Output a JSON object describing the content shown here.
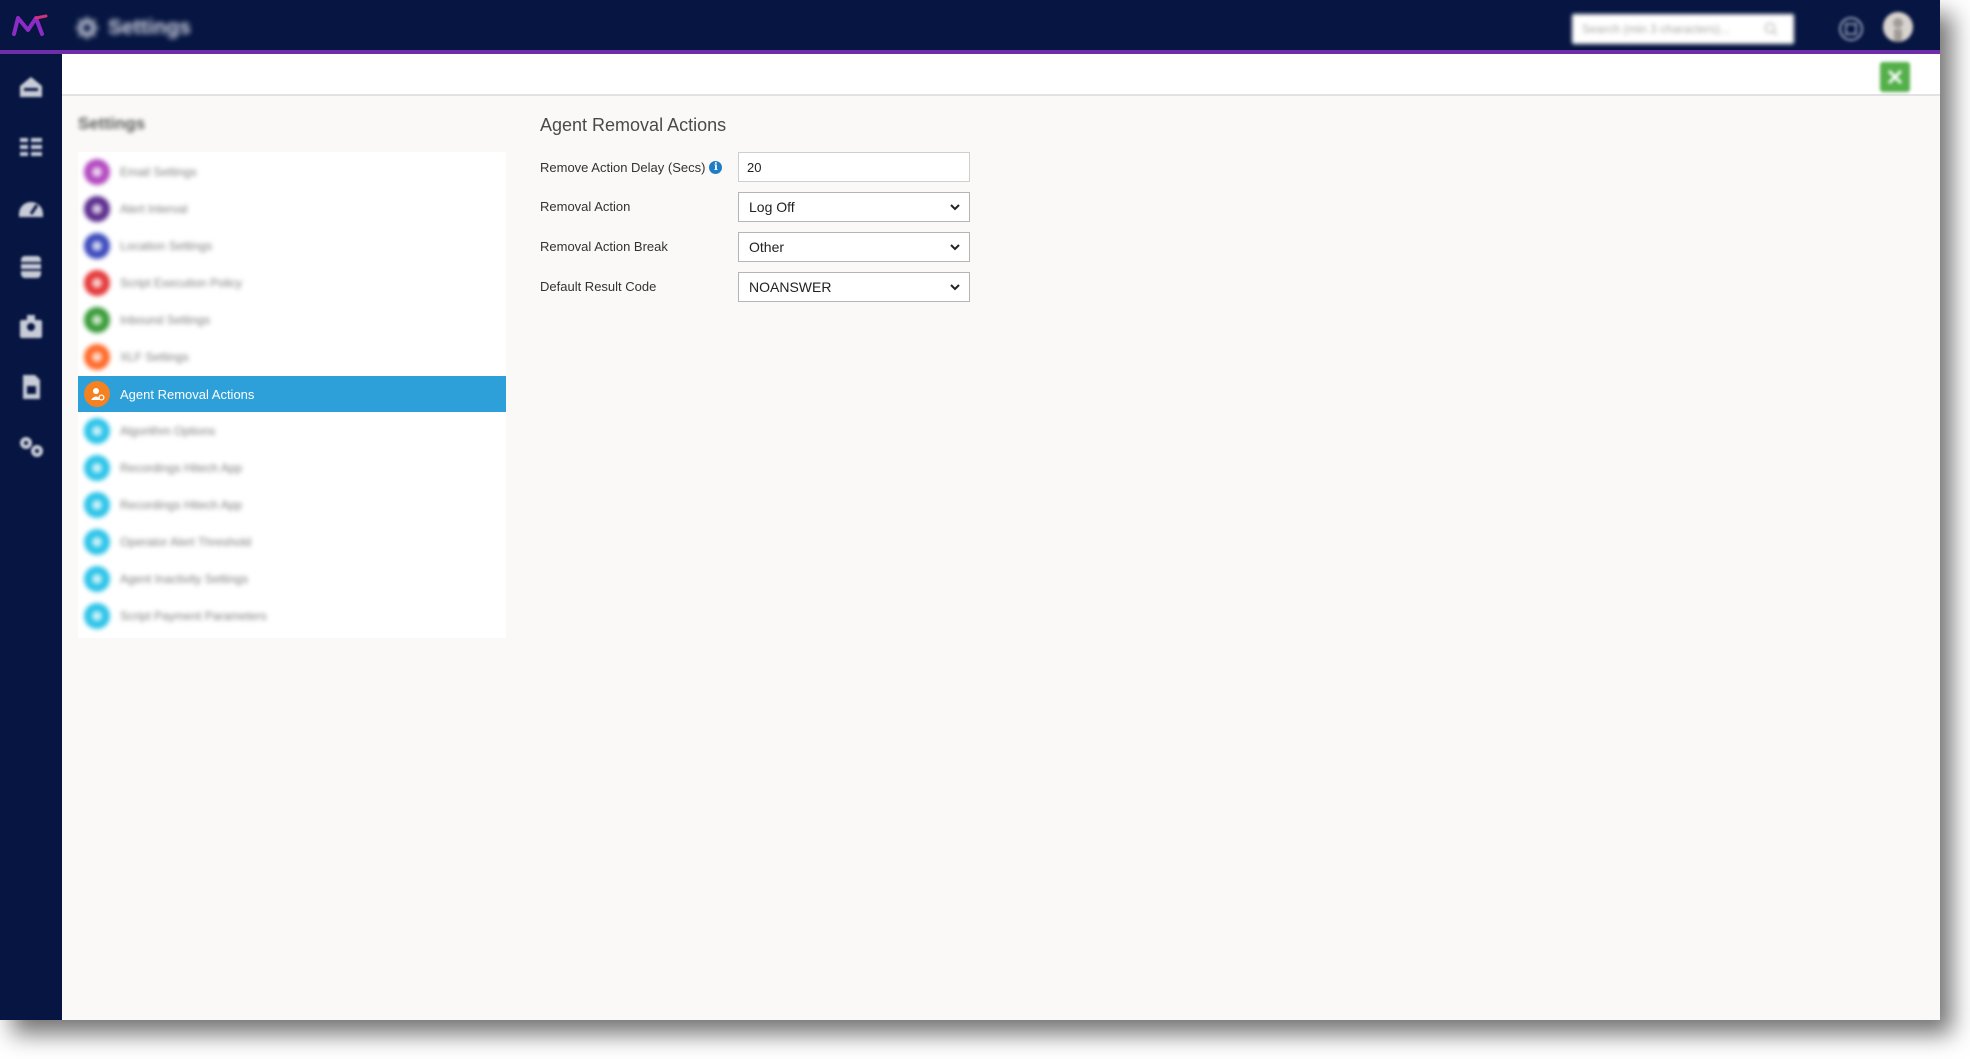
{
  "header": {
    "title": "Settings",
    "search_placeholder": "Search (min 3 characters)...",
    "accent_color": "#6f2da8",
    "bar_color": "#061541"
  },
  "left_nav": {
    "icons": [
      "home-icon",
      "grid-icon",
      "dashboard-icon",
      "database-icon",
      "contacts-icon",
      "document-icon",
      "tools-icon"
    ]
  },
  "toolbar": {
    "export_icon": "spreadsheet-export-icon",
    "export_color": "#54b04a"
  },
  "settings_list": {
    "heading": "Settings",
    "items": [
      {
        "label": "Email Settings",
        "color": "#b24ac0"
      },
      {
        "label": "Alert Interval",
        "color": "#5b2d8e"
      },
      {
        "label": "Location Settings",
        "color": "#3c4bbd"
      },
      {
        "label": "Script Execution Policy",
        "color": "#e53a3a"
      },
      {
        "label": "Inbound Settings",
        "color": "#3a9c3a"
      },
      {
        "label": "XLF Settings",
        "color": "#ff6a2a"
      },
      {
        "label": "Agent Removal Actions",
        "color": "#f58220",
        "active": true
      },
      {
        "label": "Algorithm Options",
        "color": "#2dc4e8"
      },
      {
        "label": "Recordings Hitech App",
        "color": "#2dc4e8"
      },
      {
        "label": "Recordings Hitech App",
        "color": "#2dc4e8"
      },
      {
        "label": "Operator Alert Threshold",
        "color": "#2dc4e8"
      },
      {
        "label": "Agent Inactivity Settings",
        "color": "#2dc4e8"
      },
      {
        "label": "Script Payment Parameters",
        "color": "#2dc4e8"
      }
    ],
    "active_color": "#2d9fd9"
  },
  "form": {
    "title": "Agent Removal Actions",
    "fields": [
      {
        "label": "Remove Action Delay (Secs)",
        "value": "20",
        "info": true
      },
      {
        "label": "Removal Action",
        "value": "Log Off"
      },
      {
        "label": "Removal Action Break",
        "value": "Other"
      },
      {
        "label": "Default Result Code",
        "value": "NOANSWER"
      }
    ]
  }
}
